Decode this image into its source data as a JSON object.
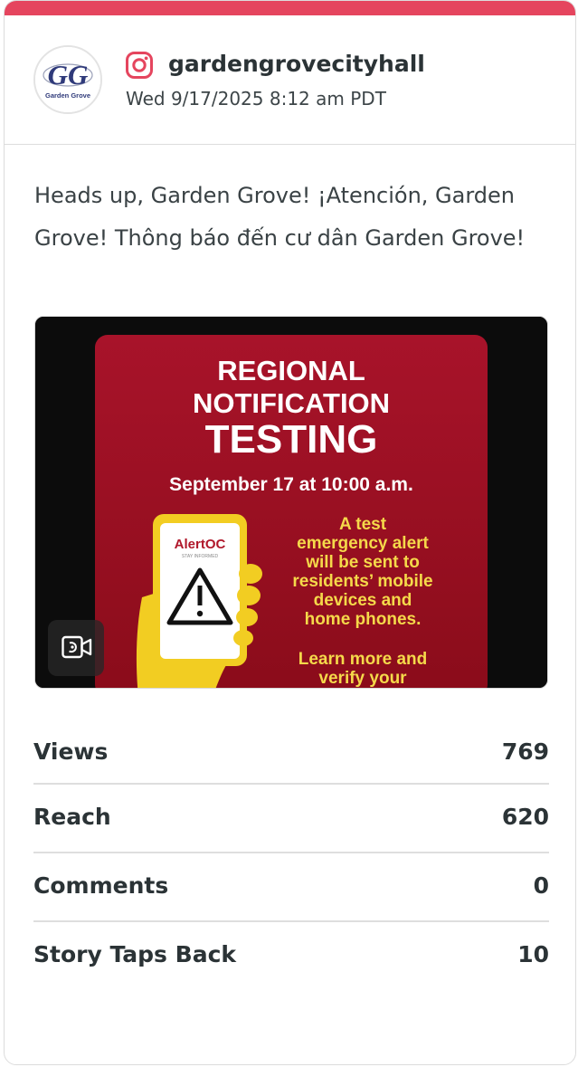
{
  "post": {
    "username": "gardengrovecityhall",
    "timestamp": "Wed 9/17/2025 8:12 am PDT",
    "caption": "Heads up, Garden Grove! ¡Atención, Garden Grove! Thông báo đến cư dân Garden Grove!",
    "platform_icon": "instagram-icon",
    "avatar_logo": {
      "text": "Garden Grove",
      "initials": "GG"
    }
  },
  "media": {
    "type_icon": "video-icon",
    "poster": {
      "line1": "REGIONAL",
      "line2": "NOTIFICATION",
      "line3": "TESTING",
      "date": "September 17 at 10:00 a.m.",
      "app_name": "AlertOC",
      "app_tagline": "STAY INFORMED",
      "body": [
        "A test",
        "emergency alert",
        "will be sent to",
        "residents’ mobile",
        "devices and",
        "home phones.",
        "",
        "Learn more and",
        "verify your"
      ],
      "colors": {
        "background": "#0c0c0c",
        "panel": "#9c0f1f",
        "title_text": "#ffffff",
        "body_text": "#f5d94a",
        "hand": "#f2cd22"
      }
    }
  },
  "stats": [
    {
      "label": "Views",
      "value": "769"
    },
    {
      "label": "Reach",
      "value": "620"
    },
    {
      "label": "Comments",
      "value": "0"
    },
    {
      "label": "Story Taps Back",
      "value": "10"
    }
  ],
  "colors": {
    "accent_bar": "#e5455e",
    "text": "#2b3336",
    "divider": "#dedede"
  }
}
